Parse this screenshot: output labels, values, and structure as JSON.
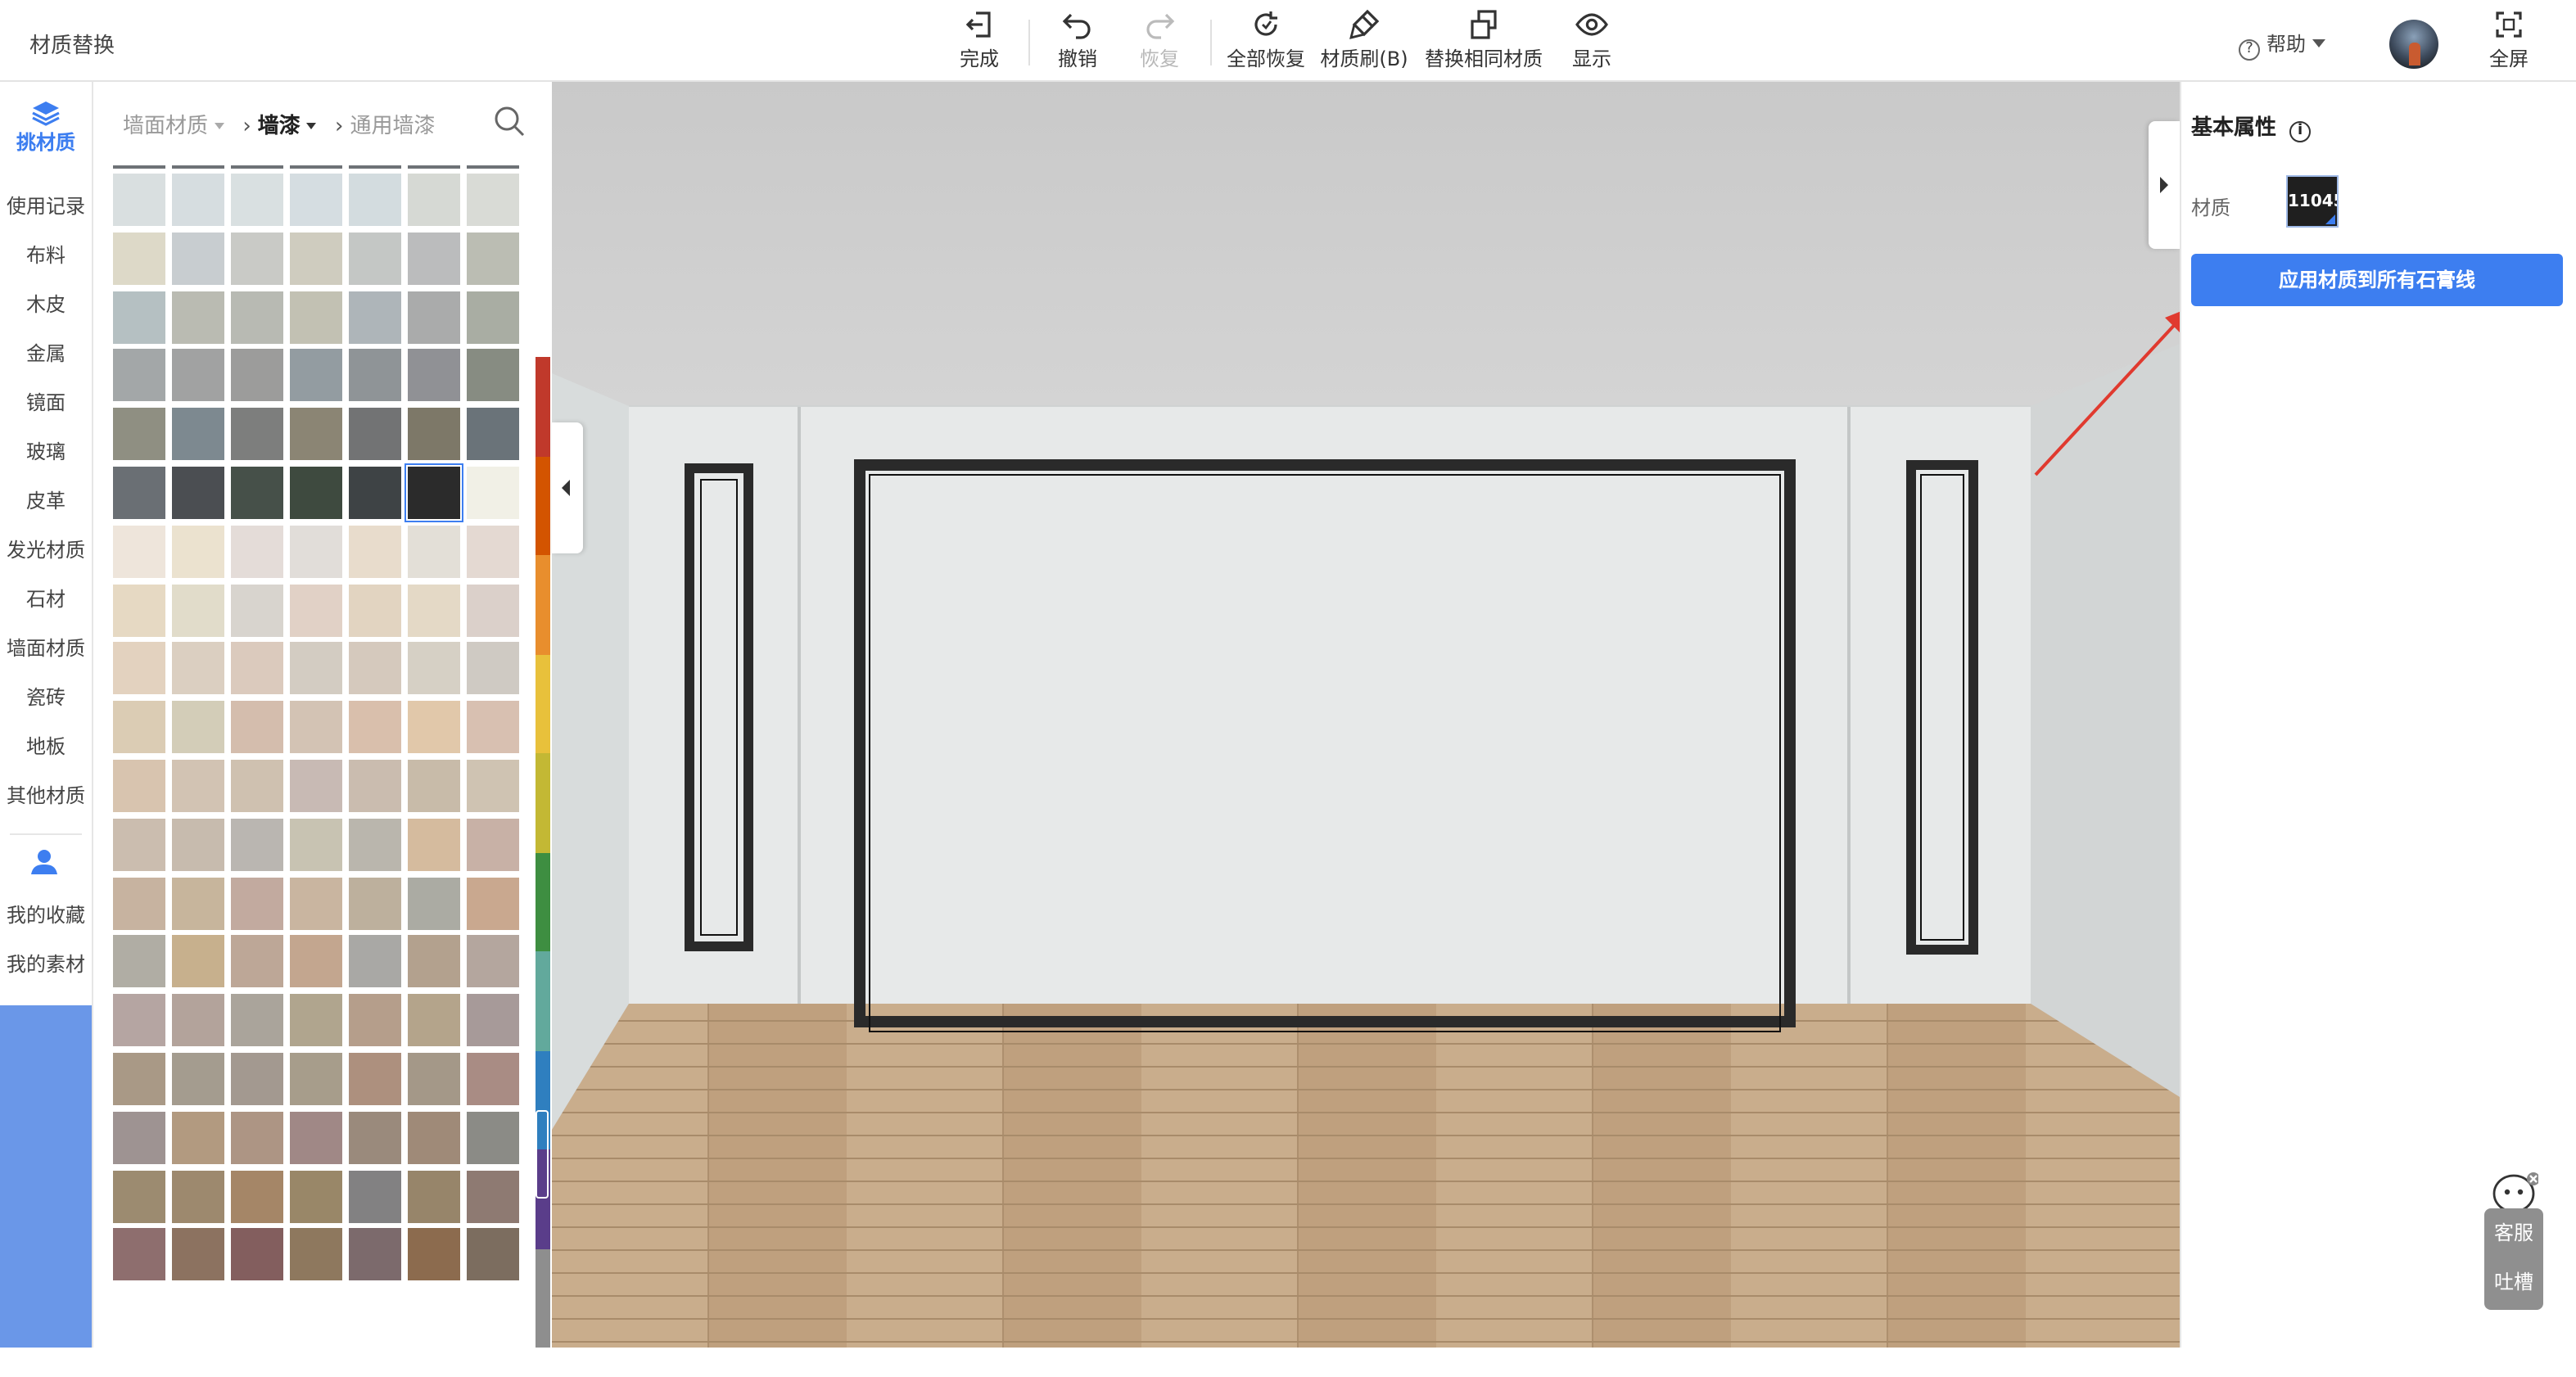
{
  "app": {
    "title": "材质替换"
  },
  "toolbar": {
    "items": [
      {
        "label": "完成",
        "icon": "exit-icon",
        "enabled": true
      },
      {
        "label": "撤销",
        "icon": "undo-icon",
        "enabled": true
      },
      {
        "label": "恢复",
        "icon": "redo-icon",
        "enabled": false
      },
      {
        "label": "全部恢复",
        "icon": "restore-all-icon",
        "enabled": true
      },
      {
        "label": "材质刷(B)",
        "icon": "brush-icon",
        "enabled": true
      },
      {
        "label": "替换相同材质",
        "icon": "replace-same-icon",
        "enabled": true
      },
      {
        "label": "显示",
        "icon": "eye-icon",
        "enabled": true
      }
    ],
    "help_label": "帮助",
    "fullscreen_label": "全屏"
  },
  "categories": {
    "active": "挑材质",
    "items": [
      "使用记录",
      "布料",
      "木皮",
      "金属",
      "镜面",
      "玻璃",
      "皮革",
      "发光材质",
      "石材",
      "墙面材质",
      "瓷砖",
      "地板",
      "其他材质"
    ],
    "user_items": [
      "我的收藏",
      "我的素材"
    ]
  },
  "breadcrumb": {
    "level1": "墙面材质",
    "level2": "墙漆",
    "level3": "通用墙漆"
  },
  "swatches": {
    "rows": [
      [
        "#d9dfe0",
        "#d6dde0",
        "#d9e0e1",
        "#d5dde1",
        "#d3dcdf",
        "#d6d9d4",
        "#d9dbd6"
      ],
      [
        "#ddd9c8",
        "#c8cdd0",
        "#c9cac6",
        "#cfccbf",
        "#c4c7c5",
        "#bbbcbd",
        "#bbbdb3"
      ],
      [
        "#b5c0c2",
        "#babbb2",
        "#b8bab3",
        "#c2c1b3",
        "#aeb5b9",
        "#aaabab",
        "#a9ada3"
      ],
      [
        "#a3a7a8",
        "#a1a2a2",
        "#9c9c9b",
        "#939ca1",
        "#8f9497",
        "#909195",
        "#878c82"
      ],
      [
        "#8f8f82",
        "#7d8990",
        "#7d7e7d",
        "#8b8574",
        "#727374",
        "#7d7868",
        "#6a7379"
      ],
      [
        "#6a6f74",
        "#4b4e52",
        "#465049",
        "#3e4a3f",
        "#3e4345",
        "#2b2b2b",
        "#f1f0e6"
      ],
      [
        "#eee5db",
        "#ebe2cf",
        "#e4dcd8",
        "#e1ddd9",
        "#e8dccc",
        "#e3dfd7",
        "#e4d9d2"
      ],
      [
        "#e6d9c3",
        "#e1dcca",
        "#d8d4ce",
        "#e1d1c6",
        "#e2d4c1",
        "#e4d9c6",
        "#dbd0ca"
      ],
      [
        "#e3d2bf",
        "#dbcfc1",
        "#dbcabd",
        "#d3ccc2",
        "#d5c9bd",
        "#d6d0c5",
        "#cfcac3"
      ],
      [
        "#dbccb4",
        "#d3cdb8",
        "#d4bdad",
        "#d3c3b4",
        "#d9bfac",
        "#e1c8aa",
        "#d8c0b1"
      ],
      [
        "#d8c4af",
        "#d2c3b3",
        "#cfc1b0",
        "#c8bab4",
        "#cabcaf",
        "#c8bba9",
        "#cfc3b2"
      ],
      [
        "#cbbdaf",
        "#c7bbae",
        "#bab6b1",
        "#c8c3b2",
        "#bab6ad",
        "#d5bb9e",
        "#c8b1a6"
      ],
      [
        "#c7b3a0",
        "#c7b59c",
        "#c2aa9f",
        "#c9b5a0",
        "#bdb09d",
        "#ababa3",
        "#c9a88f"
      ],
      [
        "#b0ada4",
        "#c7b08d",
        "#bda797",
        "#c3a68f",
        "#a9a8a5",
        "#b3a18e",
        "#b4a69e"
      ],
      [
        "#b5a5a2",
        "#b3a39b",
        "#aaa49b",
        "#b0a58e",
        "#b59e8b",
        "#b4a48b",
        "#a79a99"
      ],
      [
        "#a99986",
        "#a49c8f",
        "#a39990",
        "#a79d8b",
        "#ad907e",
        "#a49888",
        "#a98c84"
      ],
      [
        "#9e9392",
        "#b29a80",
        "#ad9584",
        "#a08886",
        "#9a8a7c",
        "#9f8a78",
        "#8b8b86"
      ],
      [
        "#9c8b70",
        "#9d896e",
        "#a58667",
        "#998768",
        "#828182",
        "#97856a",
        "#8e7a72"
      ],
      [
        "#8e6e6e",
        "#8c7260",
        "#835e5e",
        "#8e785e",
        "#7c6a6c",
        "#8c6b4e",
        "#7c6d5f"
      ]
    ],
    "selected": [
      5,
      5
    ]
  },
  "color_strip": [
    "#ffffff",
    "#c0392b",
    "#d35400",
    "#e88e2d",
    "#e8c13b",
    "#c3b834",
    "#3e8e41",
    "#62a99c",
    "#2f7fbf",
    "#5a3d8a",
    "#8e8e8e"
  ],
  "properties": {
    "title": "基本属性",
    "material_label": "材质",
    "material_code": "11045",
    "apply_button": "应用材质到所有石膏线"
  },
  "service": {
    "line1": "客服",
    "line2": "吐槽"
  },
  "colors": {
    "accent": "#3d7ef0",
    "annotation_arrow": "#e03a2f"
  }
}
